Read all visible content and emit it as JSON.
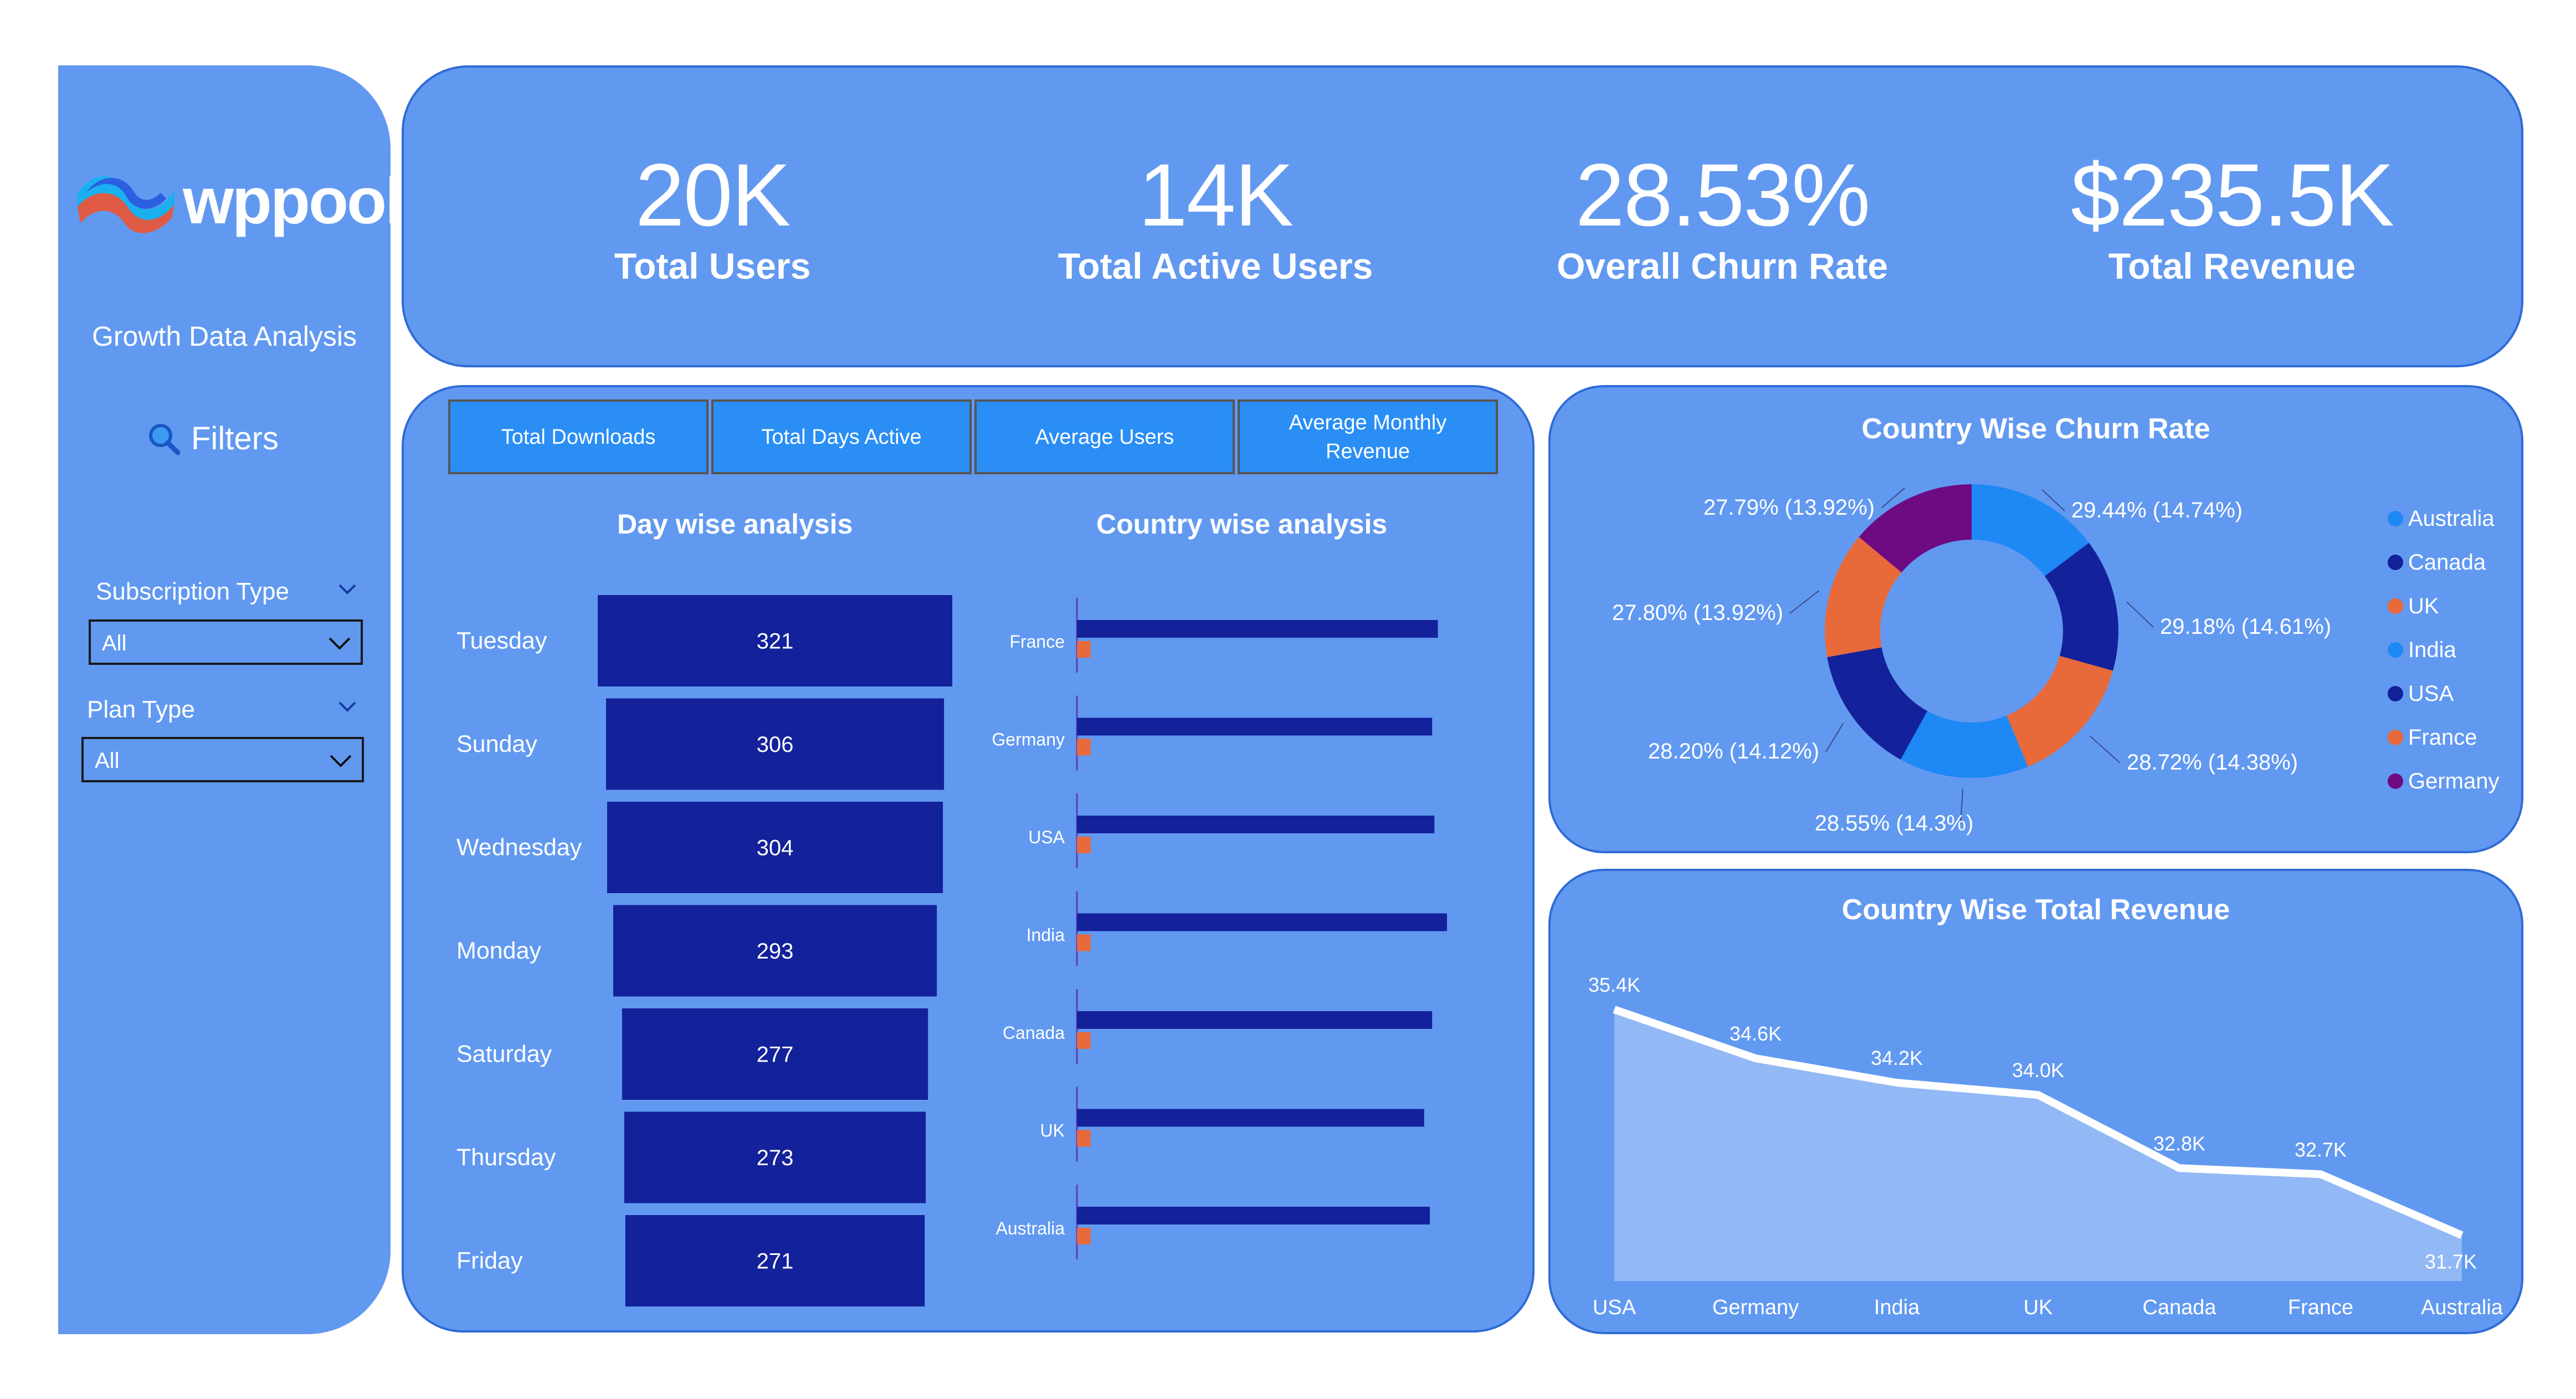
{
  "brand": {
    "logo_text": "wppool",
    "subtitle": "Growth Data Analysis"
  },
  "filters": {
    "title": "Filters",
    "subscription_label": "Subscription Type",
    "subscription_value": "All",
    "plan_label": "Plan Type",
    "plan_value": "All"
  },
  "kpis": [
    {
      "value": "20K",
      "label": "Total Users"
    },
    {
      "value": "14K",
      "label": "Total Active Users"
    },
    {
      "value": "28.53%",
      "label": "Overall Churn Rate"
    },
    {
      "value": "$235.5K",
      "label": "Total Revenue"
    }
  ],
  "tabs": [
    "Total Downloads",
    "Total Days Active",
    "Average Users",
    "Average Monthly Revenue"
  ],
  "colors": {
    "panel": "#6199f0",
    "navy": "#13219a",
    "orange": "#e8693a",
    "blue": "#1e88f5",
    "purple": "#6e0a82",
    "area": "#92b9f5"
  },
  "chart_data": [
    {
      "type": "bar",
      "title": "Day wise analysis",
      "categories": [
        "Tuesday",
        "Sunday",
        "Wednesday",
        "Monday",
        "Saturday",
        "Thursday",
        "Friday"
      ],
      "values": [
        321,
        306,
        304,
        293,
        277,
        273,
        271
      ]
    },
    {
      "type": "bar",
      "title": "Country wise analysis",
      "categories": [
        "France",
        "Germany",
        "USA",
        "India",
        "Canada",
        "UK",
        "Australia"
      ],
      "series": [
        {
          "values": [
            3160,
            3110,
            3130,
            3240,
            3110,
            3040,
            3090
          ]
        },
        {
          "values": [
            120,
            120,
            120,
            120,
            120,
            120,
            120
          ]
        }
      ]
    },
    {
      "type": "pie",
      "title": "Country Wise Churn Rate",
      "categories": [
        "Australia",
        "Canada",
        "UK",
        "India",
        "USA",
        "France",
        "Germany"
      ],
      "values": [
        14.74,
        14.61,
        14.38,
        14.3,
        14.12,
        13.92,
        13.92
      ],
      "labels": [
        "29.44% (14.74%)",
        "29.18% (14.61%)",
        "28.72% (14.38%)",
        "28.55% (14.3%)",
        "28.20% (14.12%)",
        "27.80% (13.92%)",
        "27.79% (13.92%)"
      ],
      "colors": [
        "#1e88f5",
        "#13219a",
        "#e8693a",
        "#1e88f5",
        "#13219a",
        "#e8693a",
        "#6e0a82"
      ],
      "legend": [
        "Australia",
        "Canada",
        "UK",
        "India",
        "USA",
        "France",
        "Germany"
      ],
      "legend_position": "right"
    },
    {
      "type": "area",
      "title": "Country Wise Total Revenue",
      "categories": [
        "USA",
        "Germany",
        "India",
        "UK",
        "Canada",
        "France",
        "Australia"
      ],
      "values": [
        35.4,
        34.6,
        34.2,
        34.0,
        32.8,
        32.7,
        31.7
      ],
      "labels": [
        "35.4K",
        "34.6K",
        "34.2K",
        "34.0K",
        "32.8K",
        "32.7K",
        "31.7K"
      ]
    }
  ]
}
